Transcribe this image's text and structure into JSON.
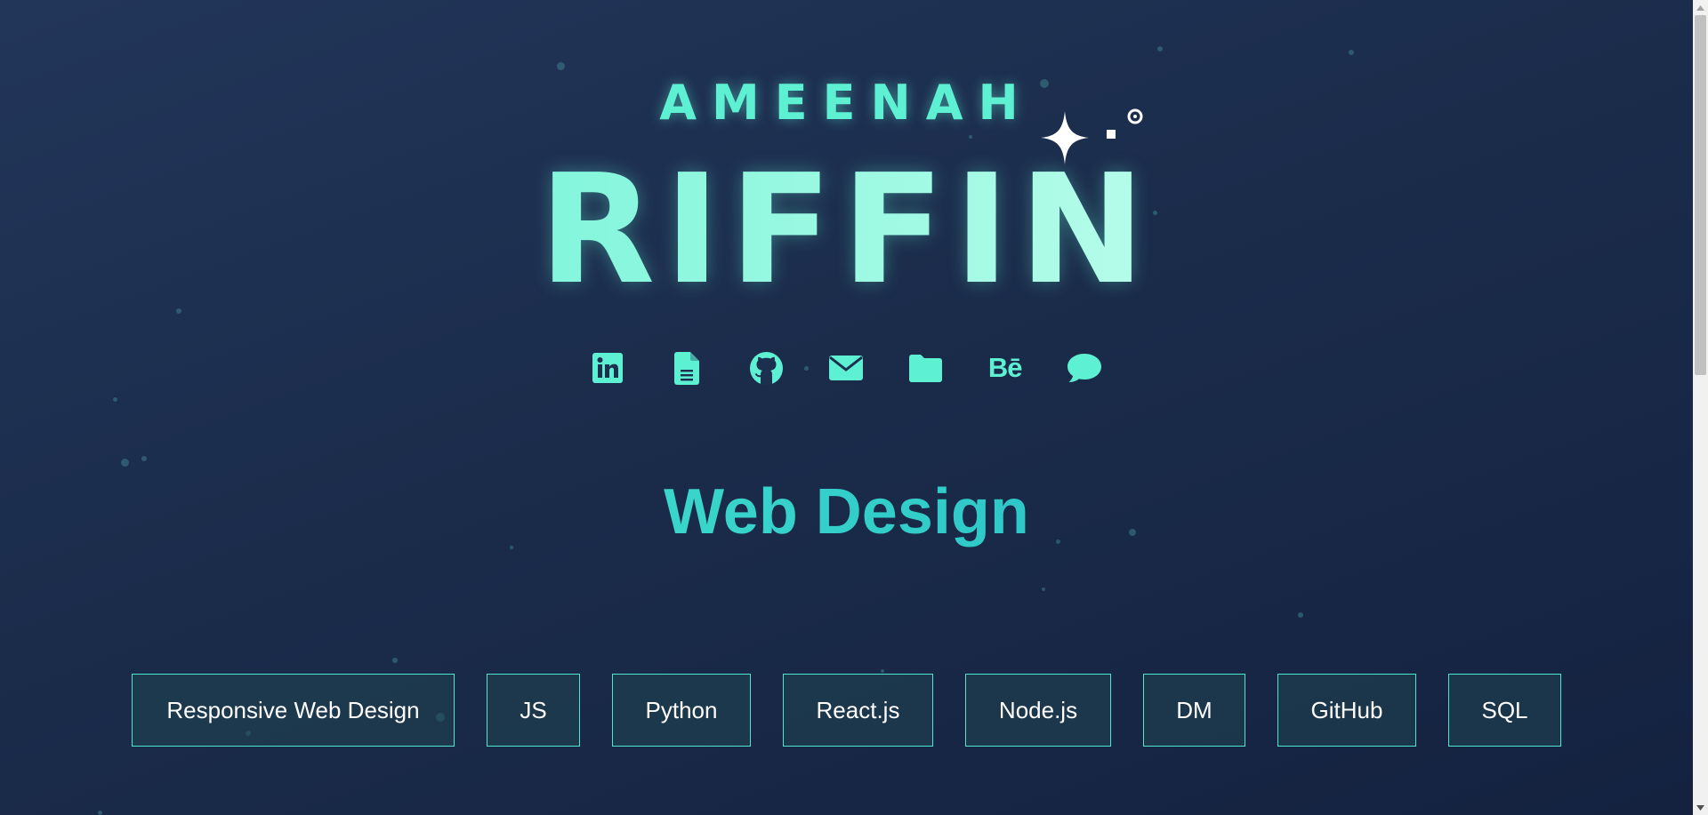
{
  "hero": {
    "first_name": "AMEENAH",
    "last_name": "RIFFIN"
  },
  "social_links": [
    {
      "icon": "linkedin-icon"
    },
    {
      "icon": "resume-document-icon"
    },
    {
      "icon": "github-icon"
    },
    {
      "icon": "envelope-icon"
    },
    {
      "icon": "folder-icon"
    },
    {
      "icon": "behance-icon",
      "text": "Bē"
    },
    {
      "icon": "chat-bubble-icon"
    }
  ],
  "section": {
    "title": "Web Design"
  },
  "skills": [
    "Responsive Web Design",
    "JS",
    "Python",
    "React.js",
    "Node.js",
    "DM",
    "GitHub",
    "SQL"
  ],
  "colors": {
    "background": "#1b2c4b",
    "accent": "#5ef0d2",
    "chip_border": "#4fe6cf",
    "chip_text": "#ffffff"
  }
}
